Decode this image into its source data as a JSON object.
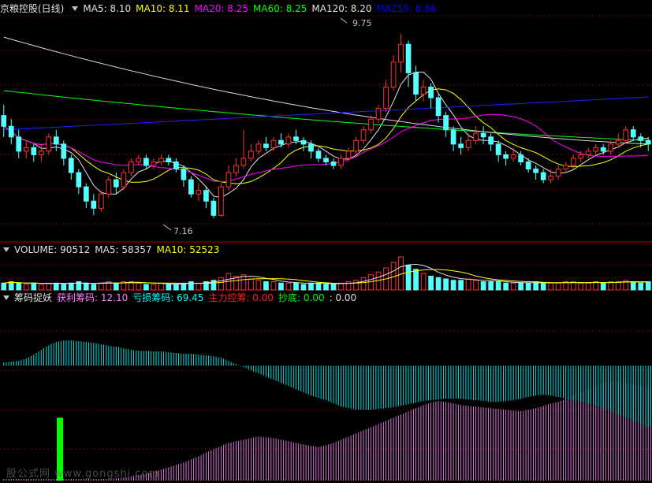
{
  "header_main": {
    "title": "京粮控股(日线)",
    "items": [
      {
        "label": "MA5: 8.10",
        "color": "#e0e0e0"
      },
      {
        "label": "MA10: 8.11",
        "color": "#ffff00"
      },
      {
        "label": "MA20: 8.25",
        "color": "#ff00ff"
      },
      {
        "label": "MA60: 8.25",
        "color": "#00ff00"
      },
      {
        "label": "MA120: 8.20",
        "color": "#e0e0e0"
      },
      {
        "label": "MA250: 8.86",
        "color": "#0000ff"
      }
    ]
  },
  "header_volume": {
    "items": [
      {
        "label": "VOLUME: 90512",
        "color": "#e0e0e0"
      },
      {
        "label": "MA5: 58357",
        "color": "#e0e0e0"
      },
      {
        "label": "MA10: 52523",
        "color": "#ffff00"
      }
    ]
  },
  "header_indicator": {
    "items": [
      {
        "label": "筹码捉妖",
        "color": "#e0e0e0"
      },
      {
        "label": "获利筹码: 12.10",
        "color": "#ff80ff"
      },
      {
        "label": "亏损筹码: 69.45",
        "color": "#00ffff"
      },
      {
        "label": "主力控筹: 0.00",
        "color": "#ff2020"
      },
      {
        "label": "抄底: 0.00",
        "color": "#00ff00"
      },
      {
        "label": ": 0.00",
        "color": "#e0e0e0"
      }
    ]
  },
  "annotations": {
    "high": "9.75",
    "low": "7.16"
  },
  "watermark": "股公式网 www.gongshi.com",
  "colors": {
    "up": "#ff3232",
    "down": "#54ffff",
    "grid": "#7a0000",
    "border": "#aa0000"
  },
  "chart_data": {
    "type": "candlestick",
    "price_range": [
      6.85,
      10.0
    ],
    "high": 9.75,
    "low": 7.16,
    "candles": [
      [
        8.6,
        8.45,
        8.75,
        8.3
      ],
      [
        8.45,
        8.3,
        8.55,
        8.2
      ],
      [
        8.3,
        8.1,
        8.4,
        8.0
      ],
      [
        8.1,
        8.15,
        8.25,
        8.0
      ],
      [
        8.15,
        8.05,
        8.2,
        7.95
      ],
      [
        8.05,
        8.1,
        8.2,
        7.95
      ],
      [
        8.1,
        8.3,
        8.35,
        8.05
      ],
      [
        8.3,
        8.2,
        8.4,
        8.1
      ],
      [
        8.2,
        8.0,
        8.25,
        7.9
      ],
      [
        8.0,
        7.8,
        8.05,
        7.7
      ],
      [
        7.8,
        7.6,
        7.85,
        7.5
      ],
      [
        7.6,
        7.4,
        7.65,
        7.3
      ],
      [
        7.4,
        7.3,
        7.5,
        7.2
      ],
      [
        7.3,
        7.5,
        7.55,
        7.25
      ],
      [
        7.5,
        7.7,
        7.75,
        7.45
      ],
      [
        7.7,
        7.6,
        7.8,
        7.5
      ],
      [
        7.6,
        7.8,
        7.85,
        7.55
      ],
      [
        7.8,
        7.95,
        8.0,
        7.75
      ],
      [
        7.95,
        8.0,
        8.05,
        7.9
      ],
      [
        8.0,
        7.9,
        8.05,
        7.85
      ],
      [
        7.9,
        7.95,
        8.0,
        7.85
      ],
      [
        7.95,
        8.0,
        8.05,
        7.9
      ],
      [
        8.0,
        7.95,
        8.05,
        7.9
      ],
      [
        7.95,
        7.85,
        8.0,
        7.8
      ],
      [
        7.85,
        7.7,
        7.9,
        7.6
      ],
      [
        7.7,
        7.5,
        7.75,
        7.45
      ],
      [
        7.5,
        7.55,
        7.65,
        7.4
      ],
      [
        7.55,
        7.4,
        7.6,
        7.3
      ],
      [
        7.4,
        7.2,
        7.45,
        7.16
      ],
      [
        7.2,
        7.6,
        7.65,
        7.18
      ],
      [
        7.6,
        7.8,
        7.9,
        7.55
      ],
      [
        7.8,
        7.9,
        8.0,
        7.75
      ],
      [
        7.9,
        8.0,
        8.4,
        7.85
      ],
      [
        8.0,
        8.1,
        8.2,
        7.95
      ],
      [
        8.1,
        8.2,
        8.25,
        8.05
      ],
      [
        8.2,
        8.15,
        8.3,
        8.1
      ],
      [
        8.15,
        8.25,
        8.3,
        8.1
      ],
      [
        8.25,
        8.2,
        8.35,
        8.15
      ],
      [
        8.2,
        8.3,
        8.35,
        8.15
      ],
      [
        8.3,
        8.25,
        8.4,
        8.2
      ],
      [
        8.25,
        8.2,
        8.3,
        8.1
      ],
      [
        8.2,
        8.1,
        8.25,
        8.0
      ],
      [
        8.1,
        8.0,
        8.15,
        7.95
      ],
      [
        8.0,
        7.95,
        8.05,
        7.9
      ],
      [
        7.95,
        7.9,
        8.0,
        7.85
      ],
      [
        7.9,
        8.0,
        8.05,
        7.85
      ],
      [
        8.0,
        8.1,
        8.15,
        7.95
      ],
      [
        8.1,
        8.25,
        8.3,
        8.05
      ],
      [
        8.25,
        8.4,
        8.45,
        8.2
      ],
      [
        8.4,
        8.55,
        8.6,
        8.35
      ],
      [
        8.55,
        8.7,
        8.75,
        8.5
      ],
      [
        8.7,
        9.0,
        9.1,
        8.65
      ],
      [
        9.0,
        9.35,
        9.45,
        8.95
      ],
      [
        9.35,
        9.6,
        9.75,
        9.2
      ],
      [
        9.6,
        9.2,
        9.65,
        9.0
      ],
      [
        9.2,
        8.9,
        9.3,
        8.8
      ],
      [
        8.9,
        9.0,
        9.1,
        8.8
      ],
      [
        9.0,
        8.85,
        9.05,
        8.7
      ],
      [
        8.85,
        8.6,
        8.9,
        8.5
      ],
      [
        8.6,
        8.4,
        8.65,
        8.3
      ],
      [
        8.4,
        8.2,
        8.45,
        8.1
      ],
      [
        8.2,
        8.15,
        8.3,
        8.05
      ],
      [
        8.15,
        8.25,
        8.35,
        8.1
      ],
      [
        8.25,
        8.35,
        8.45,
        8.2
      ],
      [
        8.35,
        8.3,
        8.45,
        8.2
      ],
      [
        8.3,
        8.2,
        8.35,
        8.1
      ],
      [
        8.2,
        8.05,
        8.25,
        7.95
      ],
      [
        8.05,
        8.0,
        8.1,
        7.9
      ],
      [
        8.0,
        8.05,
        8.15,
        7.95
      ],
      [
        8.05,
        7.95,
        8.1,
        7.9
      ],
      [
        7.95,
        7.85,
        8.0,
        7.8
      ],
      [
        7.85,
        7.8,
        7.9,
        7.7
      ],
      [
        7.8,
        7.7,
        7.85,
        7.65
      ],
      [
        7.7,
        7.75,
        7.85,
        7.65
      ],
      [
        7.75,
        7.85,
        7.9,
        7.7
      ],
      [
        7.85,
        7.9,
        7.95,
        7.8
      ],
      [
        7.9,
        8.0,
        8.05,
        7.85
      ],
      [
        8.0,
        8.05,
        8.1,
        7.95
      ],
      [
        8.05,
        8.1,
        8.15,
        8.0
      ],
      [
        8.1,
        8.15,
        8.2,
        8.05
      ],
      [
        8.15,
        8.1,
        8.2,
        8.05
      ],
      [
        8.1,
        8.2,
        8.25,
        8.05
      ],
      [
        8.2,
        8.25,
        8.35,
        8.15
      ],
      [
        8.25,
        8.4,
        8.45,
        8.2
      ],
      [
        8.4,
        8.3,
        8.45,
        8.25
      ],
      [
        8.3,
        8.25,
        8.35,
        8.15
      ],
      [
        8.25,
        8.2,
        8.3,
        8.1
      ]
    ],
    "volume": [
      5,
      6,
      5,
      4,
      5,
      4,
      5,
      5,
      4,
      5,
      6,
      5,
      4,
      5,
      6,
      5,
      6,
      6,
      5,
      4,
      4,
      5,
      4,
      4,
      5,
      6,
      5,
      6,
      7,
      9,
      12,
      10,
      11,
      8,
      7,
      6,
      6,
      5,
      5,
      5,
      4,
      5,
      5,
      4,
      4,
      5,
      6,
      7,
      9,
      11,
      13,
      16,
      20,
      24,
      18,
      15,
      12,
      10,
      9,
      8,
      7,
      7,
      8,
      7,
      6,
      6,
      6,
      5,
      5,
      5,
      5,
      6,
      5,
      5,
      5,
      6,
      6,
      5,
      5,
      6,
      5,
      6,
      6,
      7,
      6,
      5,
      6
    ],
    "profit_chips": [
      2,
      2,
      2,
      2,
      2,
      2,
      2,
      2,
      2,
      2,
      2,
      2,
      2,
      2,
      2,
      3,
      4,
      5,
      7,
      9,
      11,
      14,
      17,
      20,
      23,
      27,
      31,
      36,
      40,
      44,
      48,
      50,
      52,
      54,
      56,
      55,
      54,
      52,
      50,
      48,
      46,
      44,
      43,
      45,
      48,
      52,
      56,
      60,
      64,
      68,
      72,
      76,
      80,
      84,
      88,
      92,
      96,
      99,
      101,
      100,
      98,
      96,
      95,
      94,
      93,
      92,
      91,
      90,
      89,
      88,
      90,
      92,
      95,
      98,
      100,
      104,
      108,
      112,
      116,
      120,
      124,
      126,
      126,
      124,
      122,
      120,
      118
    ],
    "loss_chips": [
      150,
      151,
      152,
      155,
      160,
      166,
      172,
      176,
      178,
      178,
      177,
      176,
      175,
      173,
      171,
      170,
      168,
      166,
      165,
      165,
      164,
      164,
      163,
      162,
      161,
      161,
      160,
      159,
      158,
      156,
      152,
      148,
      144,
      140,
      136,
      132,
      128,
      124,
      120,
      116,
      112,
      108,
      105,
      102,
      98,
      94,
      92,
      90,
      90,
      90,
      91,
      92,
      93,
      95,
      97,
      99,
      101,
      102,
      103,
      104,
      104,
      104,
      103,
      102,
      101,
      100,
      100,
      101,
      102,
      104,
      106,
      108,
      109,
      108,
      106,
      104,
      102,
      100,
      98,
      95,
      92,
      88,
      84,
      80,
      76,
      72,
      68
    ]
  }
}
